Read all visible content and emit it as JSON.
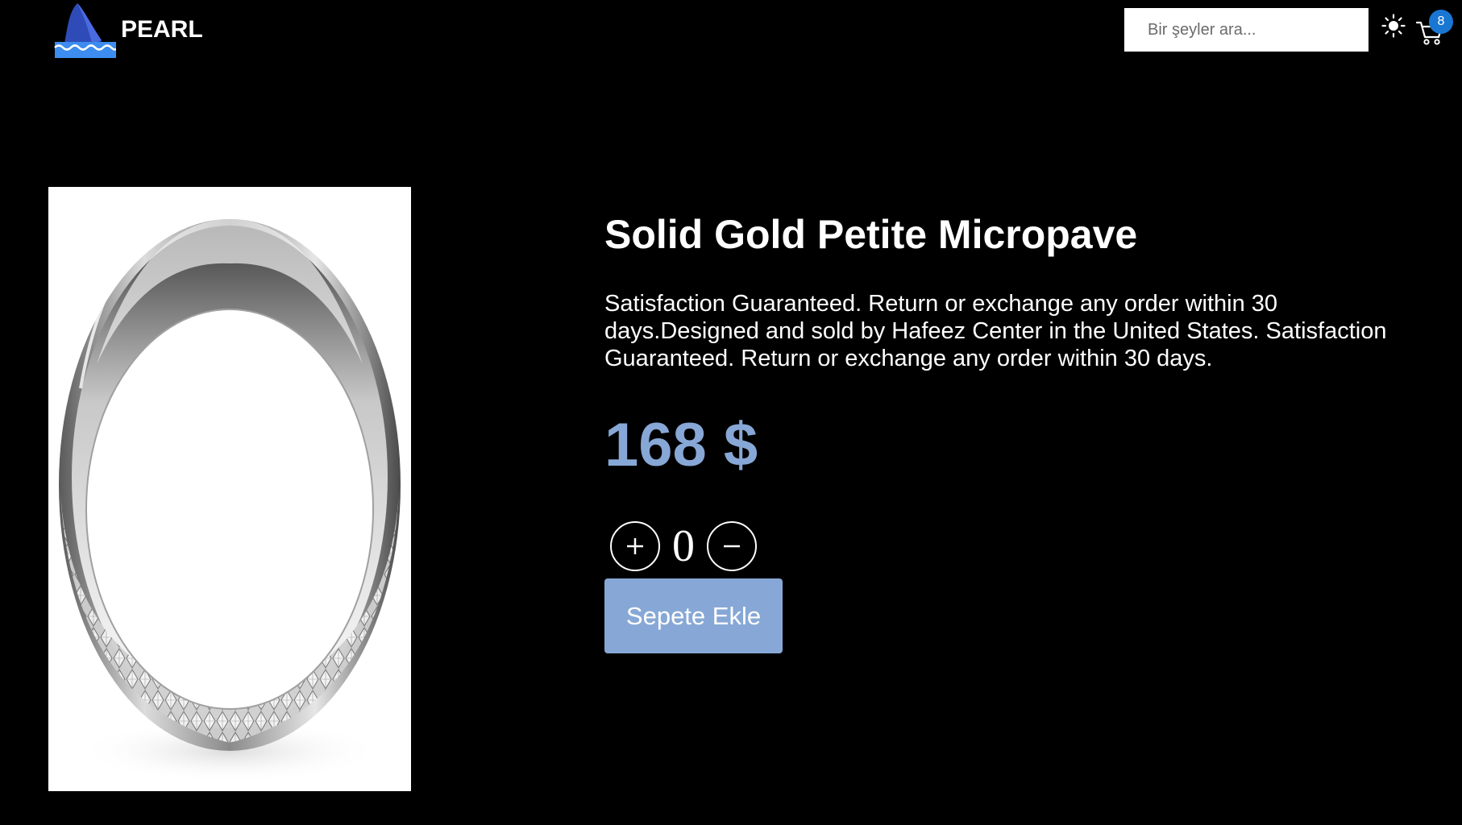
{
  "header": {
    "brand": "PEARL",
    "search_placeholder": "Bir şeyler ara...",
    "cart_count": "8",
    "icons": {
      "logo": "shark-fin-logo",
      "theme": "sun-icon",
      "cart": "cart-icon"
    },
    "colors": {
      "badge": "#1976d2",
      "logo_fin": "#3a55c2",
      "logo_water": "#3d8cf0"
    }
  },
  "product": {
    "title": "Solid Gold Petite Micropave",
    "description": "Satisfaction Guaranteed. Return or exchange any order within 30 days.Designed and sold by Hafeez Center in the United States. Satisfaction Guaranteed. Return or exchange any order within 30 days.",
    "price": "168 $",
    "quantity": "0",
    "add_to_cart_label": "Sepete Ekle",
    "image": "silver-ring-photo",
    "accent_color": "#87a8d6"
  }
}
